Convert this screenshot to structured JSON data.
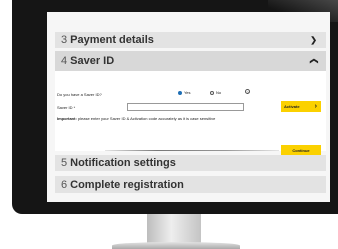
{
  "sections": [
    {
      "num": "3",
      "title": "Payment details",
      "state": "collapsed"
    },
    {
      "num": "4",
      "title": "Saver ID",
      "state": "expanded"
    },
    {
      "num": "5",
      "title": "Notification settings"
    },
    {
      "num": "6",
      "title": "Complete registration"
    }
  ],
  "saver": {
    "question": "Do you have a Saver ID?",
    "yes_label": "Yes",
    "no_label": "No",
    "selected": "Yes",
    "id_label": "Saver ID *",
    "id_value": "",
    "activate_label": "Activate",
    "important_bold": "Important:",
    "important_text": " please enter your Saver ID & Activation code accurately as it is case sensitive",
    "continue_label": "Continue"
  },
  "colors": {
    "accent": "#fbd100",
    "header_bg": "#e3e3e3",
    "radio_selected": "#1f6fb5",
    "bezel": "#151515"
  },
  "icons": {
    "section3": "chevron-down-icon",
    "section4": "chevron-up-icon",
    "activate": "arrow-right-icon",
    "help": "help-icon"
  }
}
